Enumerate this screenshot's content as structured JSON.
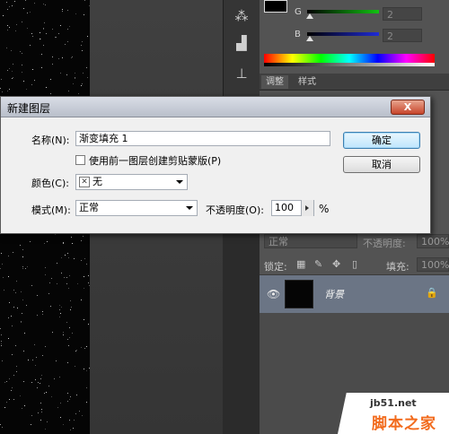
{
  "color_panel": {
    "g_label": "G",
    "b_label": "B",
    "g_value": "2",
    "b_value": "2",
    "g_track_color": "#12c212",
    "b_track_color": "#1f2bd6"
  },
  "panel_tabs": {
    "adjustments": "调整",
    "styles": "样式"
  },
  "layers_panel": {
    "blend_mode": "正常",
    "opacity_label": "不透明度:",
    "opacity_value": "100%",
    "lock_label": "锁定:",
    "fill_label": "填充:",
    "fill_value": "100%",
    "layer_name": "背景"
  },
  "dialog": {
    "title": "新建图层",
    "close": "X",
    "name_label": "名称(N):",
    "name_value": "渐变填充 1",
    "clip_checkbox_label": "使用前一图层创建剪贴蒙版(P)",
    "clip_checked": false,
    "color_label": "颜色(C):",
    "color_value": "无",
    "mode_label": "模式(M):",
    "mode_value": "正常",
    "opacity_label": "不透明度(O):",
    "opacity_value": "100",
    "percent": "%",
    "ok": "确定",
    "cancel": "取消"
  },
  "watermark": {
    "site": "jb51.net",
    "name": "脚本之家"
  }
}
